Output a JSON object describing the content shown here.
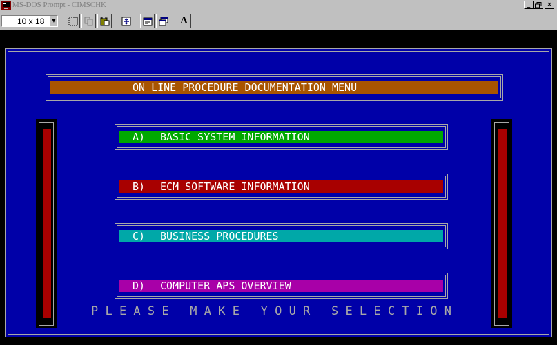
{
  "window": {
    "title": "MS-DOS Prompt - CIMSCHK",
    "controls": {
      "minimize": "_",
      "restore": "ꟿ",
      "close": "×"
    }
  },
  "toolbar": {
    "font_size": "10 x 18",
    "buttons": [
      {
        "name": "mark",
        "icon": "mark-icon"
      },
      {
        "name": "copy",
        "icon": "copy-icon"
      },
      {
        "name": "paste",
        "icon": "paste-icon"
      },
      {
        "name": "fullscreen",
        "icon": "fullscreen-icon"
      },
      {
        "name": "properties",
        "icon": "properties-icon"
      },
      {
        "name": "background",
        "icon": "background-icon"
      },
      {
        "name": "font",
        "icon": "font-icon",
        "label": "A"
      }
    ]
  },
  "menu": {
    "header": "ON LINE PROCEDURE DOCUMENTATION MENU",
    "items": [
      {
        "key": "A)",
        "label": "BASIC SYSTEM INFORMATION",
        "color": "#00a800"
      },
      {
        "key": "B)",
        "label": "ECM SOFTWARE INFORMATION",
        "color": "#a80000"
      },
      {
        "key": "C)",
        "label": "BUSINESS PROCEDURES",
        "color": "#00a8a8"
      },
      {
        "key": "D)",
        "label": "COMPUTER APS OVERVIEW",
        "color": "#a800a8"
      }
    ],
    "prompt": "P L E A S E   M A K E   Y O U R   S E L E C T I O N"
  },
  "colors": {
    "background": "#0000a8",
    "header_bar": "#a85400",
    "text": "#ffffff",
    "frame": "#a8a8a8",
    "side_bar": "#a80000"
  }
}
